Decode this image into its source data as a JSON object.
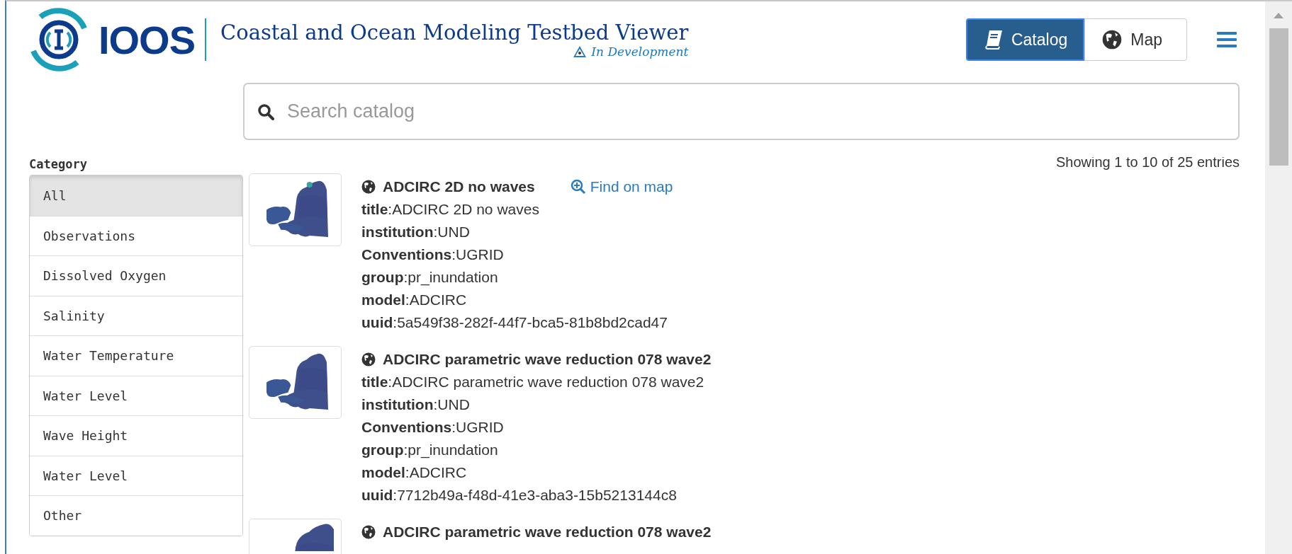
{
  "header": {
    "logo_text": "IOOS",
    "title": "Coastal and Ocean Modeling Testbed Viewer",
    "badge": "In Development"
  },
  "view_tabs": [
    {
      "label": "Catalog",
      "selected": true
    },
    {
      "label": "Map",
      "selected": false
    }
  ],
  "search": {
    "placeholder": "Search catalog"
  },
  "sidebar": {
    "heading": "Category",
    "items": [
      {
        "label": "All",
        "selected": true
      },
      {
        "label": "Observations",
        "selected": false
      },
      {
        "label": "Dissolved Oxygen",
        "selected": false
      },
      {
        "label": "Salinity",
        "selected": false
      },
      {
        "label": "Water Temperature",
        "selected": false
      },
      {
        "label": "Water Level",
        "selected": false
      },
      {
        "label": "Wave Height",
        "selected": false
      },
      {
        "label": "Water Level",
        "selected": false
      },
      {
        "label": "Other",
        "selected": false
      }
    ]
  },
  "results": {
    "summary": "Showing 1 to 10 of 25 entries",
    "entries": [
      {
        "name": "ADCIRC 2D no waves",
        "link": "Find on map",
        "fields": [
          "**title**:ADCIRC 2D no waves",
          "**institution**:UND",
          "**Conventions**:UGRID",
          "**group**:pr_inundation",
          "**model**:ADCIRC",
          "**uuid**:5a549f38-282f-44f7-bca5-81b8bd2cad47"
        ]
      },
      {
        "name": "ADCIRC parametric wave reduction 078 wave2",
        "fields": [
          "**title**:ADCIRC parametric wave reduction 078 wave2",
          "**institution**:UND",
          "**Conventions**:UGRID",
          "**group**:pr_inundation",
          "**model**:ADCIRC",
          "**uuid**:7712b49a-f48d-41e3-aba3-15b5213144c8"
        ]
      },
      {
        "name": "ADCIRC parametric wave reduction 078 wave2"
      }
    ]
  }
}
